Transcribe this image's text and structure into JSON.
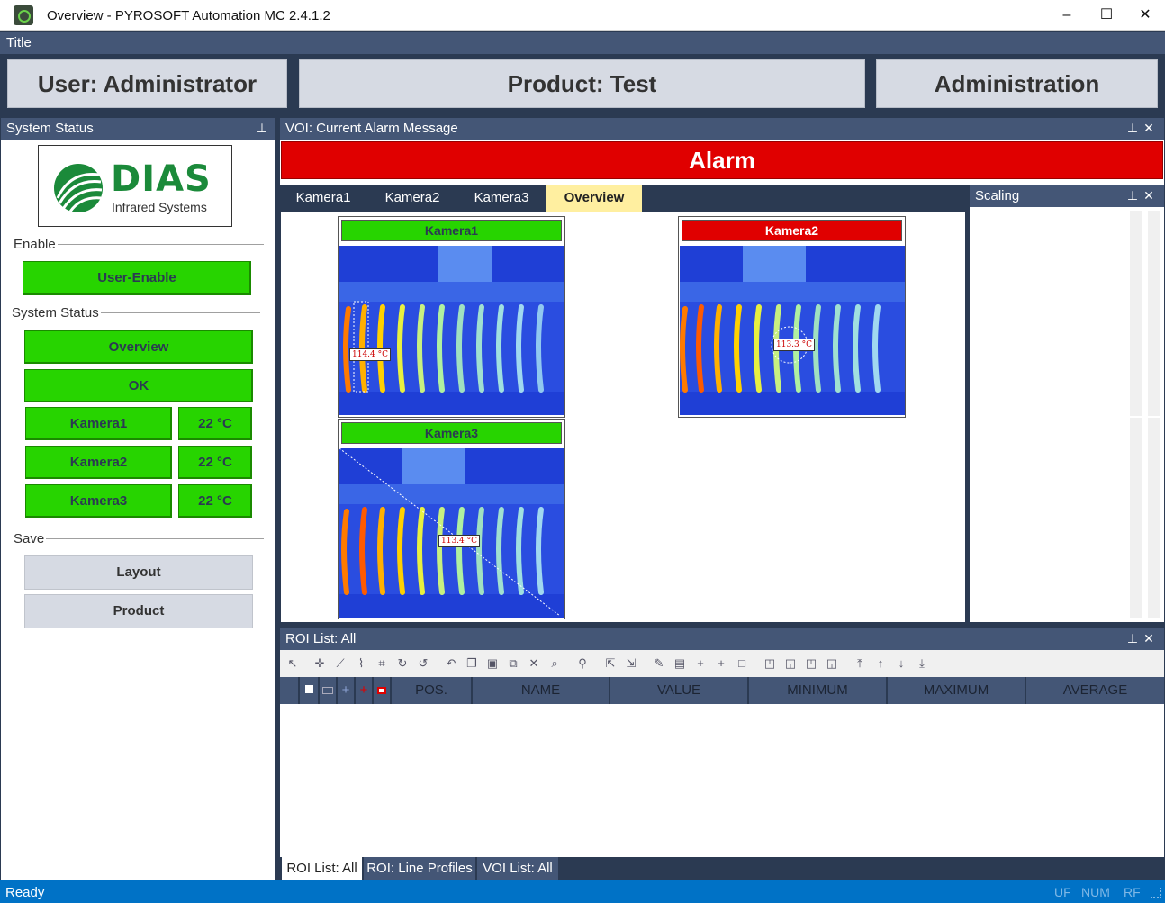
{
  "window": {
    "title": "Overview - PYROSOFT Automation MC 2.4.1.2",
    "minimize": "–",
    "maximize": "☐",
    "close": "✕"
  },
  "menu": {
    "title": "Title"
  },
  "header": {
    "user": "User: Administrator",
    "product": "Product: Test",
    "admin": "Administration"
  },
  "system_status_panel": {
    "title": "System Status",
    "pin": "⊥",
    "logo": {
      "name": "DIAS",
      "subtitle": "Infrared Systems"
    },
    "enable_group": "Enable",
    "user_enable": "User-Enable",
    "status_group": "System Status",
    "overview": "Overview",
    "ok": "OK",
    "cameras": [
      {
        "name": "Kamera1",
        "temp": "22 °C"
      },
      {
        "name": "Kamera2",
        "temp": "22 °C"
      },
      {
        "name": "Kamera3",
        "temp": "22 °C"
      }
    ],
    "save_group": "Save",
    "layout": "Layout",
    "product": "Product"
  },
  "voi_panel": {
    "title": "VOI: Current Alarm Message",
    "pin": "⊥",
    "close": "✕",
    "alarm": "Alarm",
    "tabs": [
      "Kamera1",
      "Kamera2",
      "Kamera3",
      "Overview"
    ],
    "active_tab": "Overview",
    "cameras": [
      {
        "name": "Kamera1",
        "status_color": "#27d400",
        "roi": "114.4 °C"
      },
      {
        "name": "Kamera2",
        "status_color": "#e00000",
        "roi": "113.3 °C"
      },
      {
        "name": "Kamera3",
        "status_color": "#27d400",
        "roi": "113.4 °C"
      }
    ]
  },
  "scaling_panel": {
    "title": "Scaling",
    "pin": "⊥",
    "close": "✕"
  },
  "roi_panel": {
    "title": "ROI List: All",
    "pin": "⊥",
    "close": "✕",
    "columns": [
      "POS.",
      "NAME",
      "VALUE",
      "MINIMUM",
      "MAXIMUM",
      "AVERAGE"
    ],
    "bottom_tabs": [
      "ROI List: All",
      "ROI: Line Profiles",
      "VOI List: All"
    ]
  },
  "status": {
    "text": "Ready",
    "indicators": [
      "UF",
      "NUM",
      "RF"
    ]
  },
  "colors": {
    "accent": "#445676",
    "alarm": "#e00000",
    "ok_green": "#27d400",
    "status_blue": "#0072c6"
  }
}
